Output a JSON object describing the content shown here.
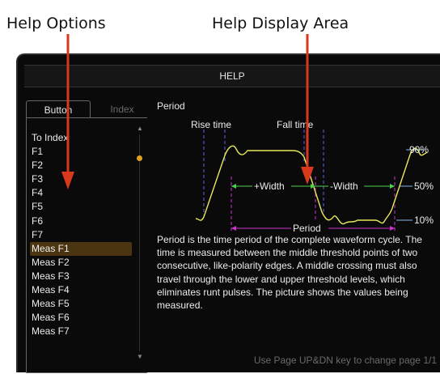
{
  "callouts": {
    "left": "Help Options",
    "right": "Help Display Area"
  },
  "window": {
    "title": "HELP"
  },
  "tabs": [
    {
      "label": "Button",
      "active": true
    },
    {
      "label": "Index",
      "active": false
    }
  ],
  "list": {
    "items": [
      "To Index",
      "F1",
      "F2",
      "F3",
      "F4",
      "F5",
      "F6",
      "F7",
      "Meas F1",
      "Meas F2",
      "Meas F3",
      "Meas F4",
      "Meas F5",
      "Meas F6",
      "Meas F7"
    ],
    "selected": "Meas F1"
  },
  "display": {
    "title": "Period",
    "diagram": {
      "rise_label": "Rise time",
      "fall_label": "Fall time",
      "pct_90": "90%",
      "pct_50": "50%",
      "pct_10": "10%",
      "pos_width": "+Width",
      "neg_width": "-Width",
      "period": "Period"
    },
    "description": "Period is the time period of the complete waveform cycle. The time is measured between the middle threshold points of two consecutive, like-polarity edges. A middle crossing must also travel through the lower and upper threshold levels, which eliminates runt pulses. The picture shows the values being measured.",
    "footer": "Use Page UP&DN key to change page  1/1"
  },
  "colors": {
    "accent": "#e0a020",
    "annotation_red": "#d8381c",
    "waveform": "#e8e85a",
    "marker": "#cc33cc",
    "levels": "#7fb8e8"
  }
}
